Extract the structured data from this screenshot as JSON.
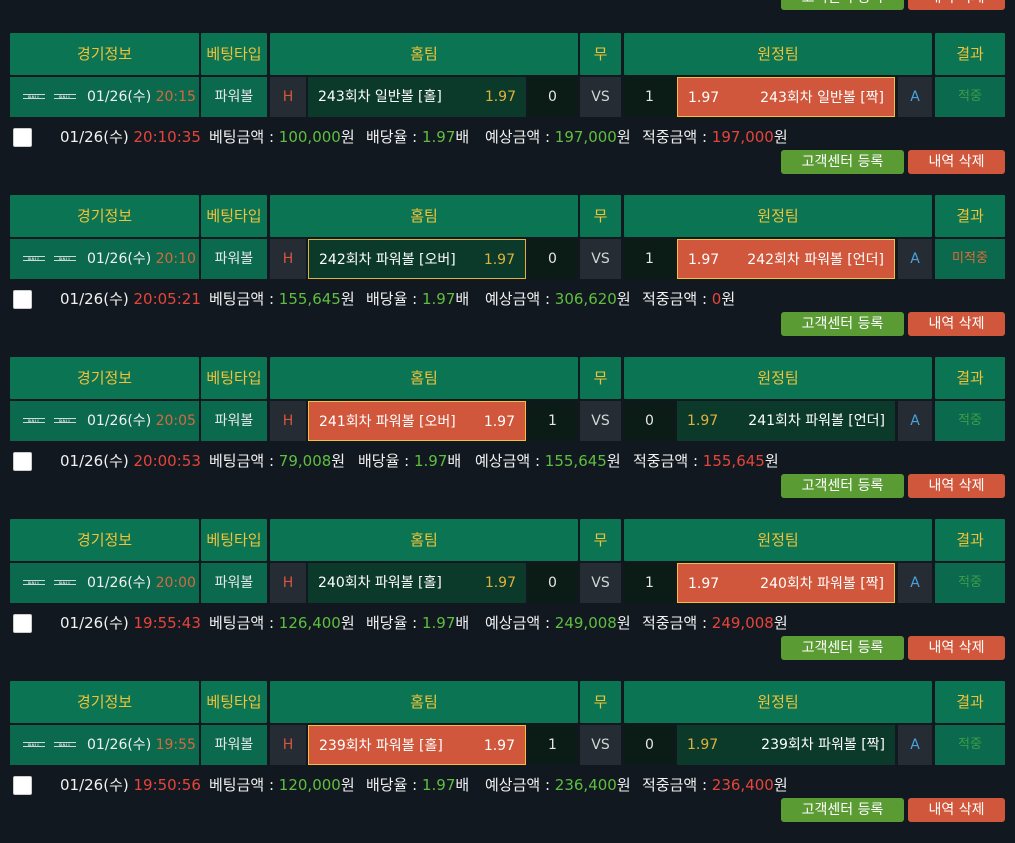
{
  "buttons": {
    "register": "고객센터 등록",
    "delete": "내역 삭제"
  },
  "headers": {
    "info": "경기정보",
    "type": "베팅타입",
    "home": "홈팀",
    "draw": "무",
    "away": "원정팀",
    "result": "결과"
  },
  "labels": {
    "bet_amount": "베팅금액 : ",
    "odds": "배당율 : ",
    "expected": "예상금액 : ",
    "win_amount": "적중금액 : ",
    "won": "원",
    "times": "배",
    "h": "H",
    "a": "A",
    "vs": "VS"
  },
  "bets": [
    {
      "date": "01/26(수) ",
      "time": "20:15",
      "type": "파워볼",
      "home_team": "243회차 일반볼 [홀]",
      "home_odds": "1.97",
      "home_score": "0",
      "away_score": "1",
      "away_team": "243회차 일반볼 [짝]",
      "away_odds": "1.97",
      "result": "적중",
      "selected": "away",
      "bet_date": "01/26(수) ",
      "bet_time": "20:10:35",
      "bet_amount": "100,000",
      "odds": "1.97",
      "expected": "197,000",
      "win_amount": "197,000"
    },
    {
      "date": "01/26(수) ",
      "time": "20:10",
      "type": "파워볼",
      "home_team": "242회차 파워볼 [오버]",
      "home_odds": "1.97",
      "home_score": "0",
      "away_score": "1",
      "away_team": "242회차 파워볼 [언더]",
      "away_odds": "1.97",
      "result": "미적중",
      "selected": "home-lose",
      "bet_date": "01/26(수) ",
      "bet_time": "20:05:21",
      "bet_amount": "155,645",
      "odds": "1.97",
      "expected": "306,620",
      "win_amount": "0"
    },
    {
      "date": "01/26(수) ",
      "time": "20:05",
      "type": "파워볼",
      "home_team": "241회차 파워볼 [오버]",
      "home_odds": "1.97",
      "home_score": "1",
      "away_score": "0",
      "away_team": "241회차 파워볼 [언더]",
      "away_odds": "1.97",
      "result": "적중",
      "selected": "home",
      "bet_date": "01/26(수) ",
      "bet_time": "20:00:53",
      "bet_amount": "79,008",
      "odds": "1.97",
      "expected": "155,645",
      "win_amount": "155,645"
    },
    {
      "date": "01/26(수) ",
      "time": "20:00",
      "type": "파워볼",
      "home_team": "240회차 파워볼 [홀]",
      "home_odds": "1.97",
      "home_score": "0",
      "away_score": "1",
      "away_team": "240회차 파워볼 [짝]",
      "away_odds": "1.97",
      "result": "적중",
      "selected": "away",
      "bet_date": "01/26(수) ",
      "bet_time": "19:55:43",
      "bet_amount": "126,400",
      "odds": "1.97",
      "expected": "249,008",
      "win_amount": "249,008"
    },
    {
      "date": "01/26(수) ",
      "time": "19:55",
      "type": "파워볼",
      "home_team": "239회차 파워볼 [홀]",
      "home_odds": "1.97",
      "home_score": "1",
      "away_score": "0",
      "away_team": "239회차 파워볼 [짝]",
      "away_odds": "1.97",
      "result": "적중",
      "selected": "home",
      "bet_date": "01/26(수) ",
      "bet_time": "19:50:56",
      "bet_amount": "120,000",
      "odds": "1.97",
      "expected": "236,400",
      "win_amount": "236,400"
    }
  ]
}
